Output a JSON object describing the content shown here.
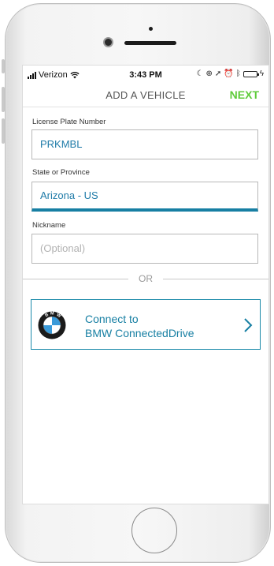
{
  "status_bar": {
    "carrier": "Verizon",
    "time": "3:43 PM"
  },
  "navbar": {
    "title": "ADD A VEHICLE",
    "next_label": "NEXT"
  },
  "form": {
    "license_plate": {
      "label": "License Plate Number",
      "value": "PRKMBL"
    },
    "state": {
      "label": "State or Province",
      "value": "Arizona - US"
    },
    "nickname": {
      "label": "Nickname",
      "placeholder": "(Optional)"
    }
  },
  "divider": {
    "text": "OR"
  },
  "connect": {
    "line1": "Connect to",
    "line2": "BMW ConnectedDrive",
    "logo_letters": "BMW"
  },
  "colors": {
    "accent": "#177fa3",
    "next_green": "#5ecb3a",
    "battery_green": "#4cd964"
  },
  "icons": [
    "signal-bars-icon",
    "wifi-icon",
    "moon-icon",
    "lock-rotation-icon",
    "location-arrow-icon",
    "alarm-icon",
    "bluetooth-icon",
    "battery-icon",
    "charging-icon",
    "bmw-logo-icon",
    "chevron-right-icon"
  ]
}
